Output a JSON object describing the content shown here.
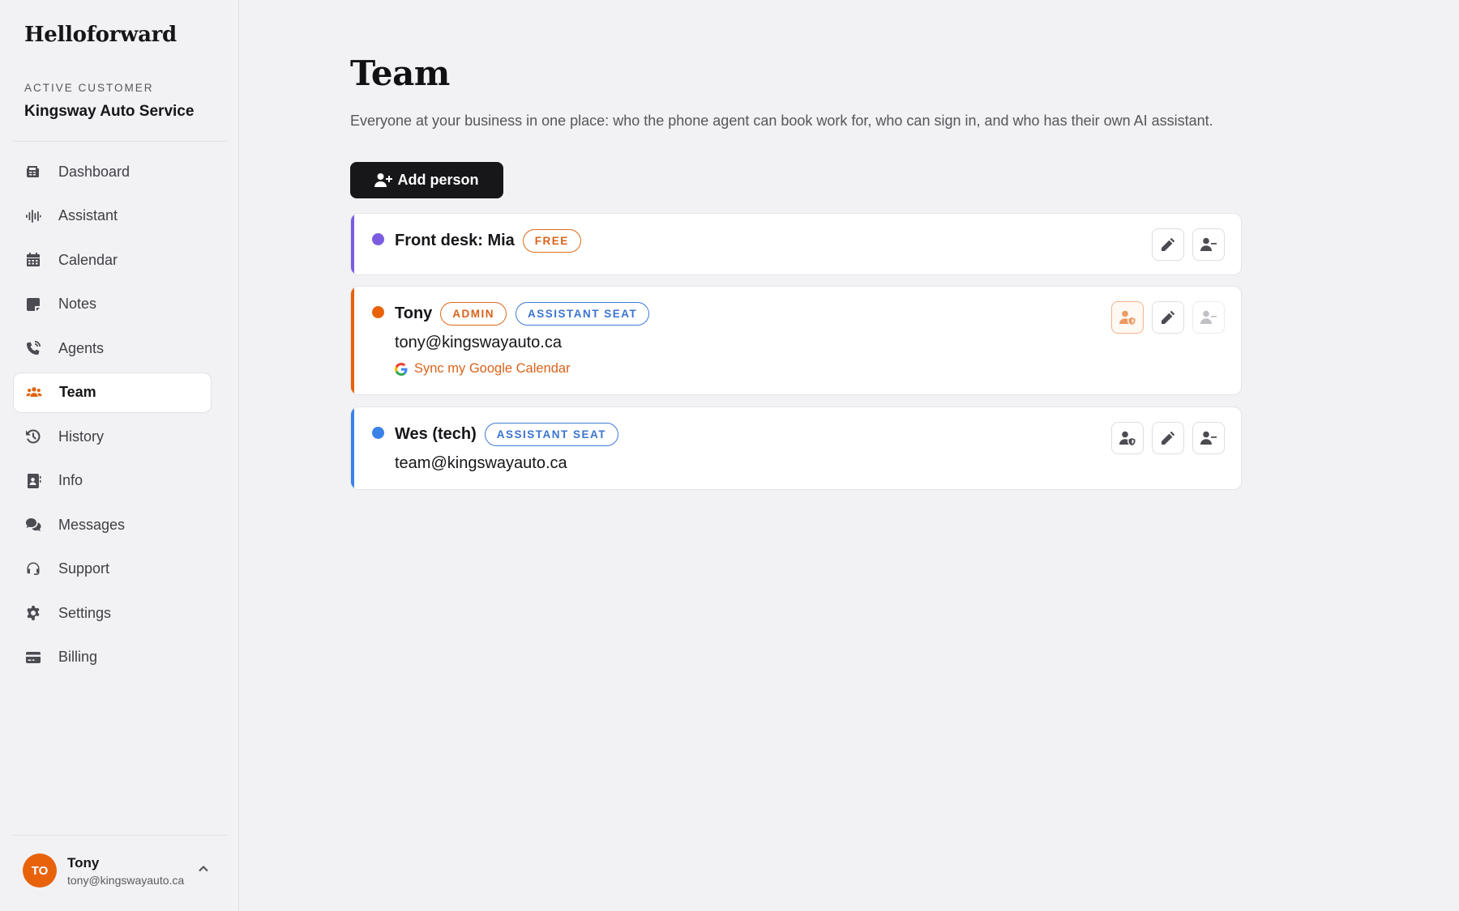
{
  "app": {
    "logo": "Helloforward"
  },
  "customer": {
    "label": "ACTIVE CUSTOMER",
    "name": "Kingsway Auto Service"
  },
  "sidebar": {
    "items": [
      {
        "label": "Dashboard",
        "icon": "newspaper-icon"
      },
      {
        "label": "Assistant",
        "icon": "waveform-icon"
      },
      {
        "label": "Calendar",
        "icon": "calendar-icon"
      },
      {
        "label": "Notes",
        "icon": "sticky-note-icon"
      },
      {
        "label": "Agents",
        "icon": "phone-volume-icon"
      },
      {
        "label": "Team",
        "icon": "users-icon",
        "active": true
      },
      {
        "label": "History",
        "icon": "history-icon"
      },
      {
        "label": "Info",
        "icon": "address-book-icon"
      },
      {
        "label": "Messages",
        "icon": "comments-icon"
      },
      {
        "label": "Support",
        "icon": "headset-icon"
      },
      {
        "label": "Settings",
        "icon": "gear-icon"
      },
      {
        "label": "Billing",
        "icon": "credit-card-icon"
      }
    ]
  },
  "user": {
    "initials": "TO",
    "name": "Tony",
    "email": "tony@kingswayauto.ca"
  },
  "main": {
    "title": "Team",
    "description": "Everyone at your business in one place: who the phone agent can book work for, who can sign in, and who has their own AI assistant.",
    "add_button_label": "Add person"
  },
  "people": [
    {
      "name": "Front desk: Mia",
      "badges": [
        "FREE"
      ],
      "color": "#7b5ce0"
    },
    {
      "name": "Tony",
      "badges": [
        "ADMIN",
        "ASSISTANT SEAT"
      ],
      "email": "tony@kingswayauto.ca",
      "sync_label": "Sync my Google Calendar",
      "color": "#e8620c"
    },
    {
      "name": "Wes (tech)",
      "badges": [
        "ASSISTANT SEAT"
      ],
      "email": "team@kingswayauto.ca",
      "color": "#3b82e8"
    }
  ],
  "colors": {
    "accent": "#e8620c",
    "blue": "#3b74cf",
    "purple": "#7b5ce0"
  }
}
